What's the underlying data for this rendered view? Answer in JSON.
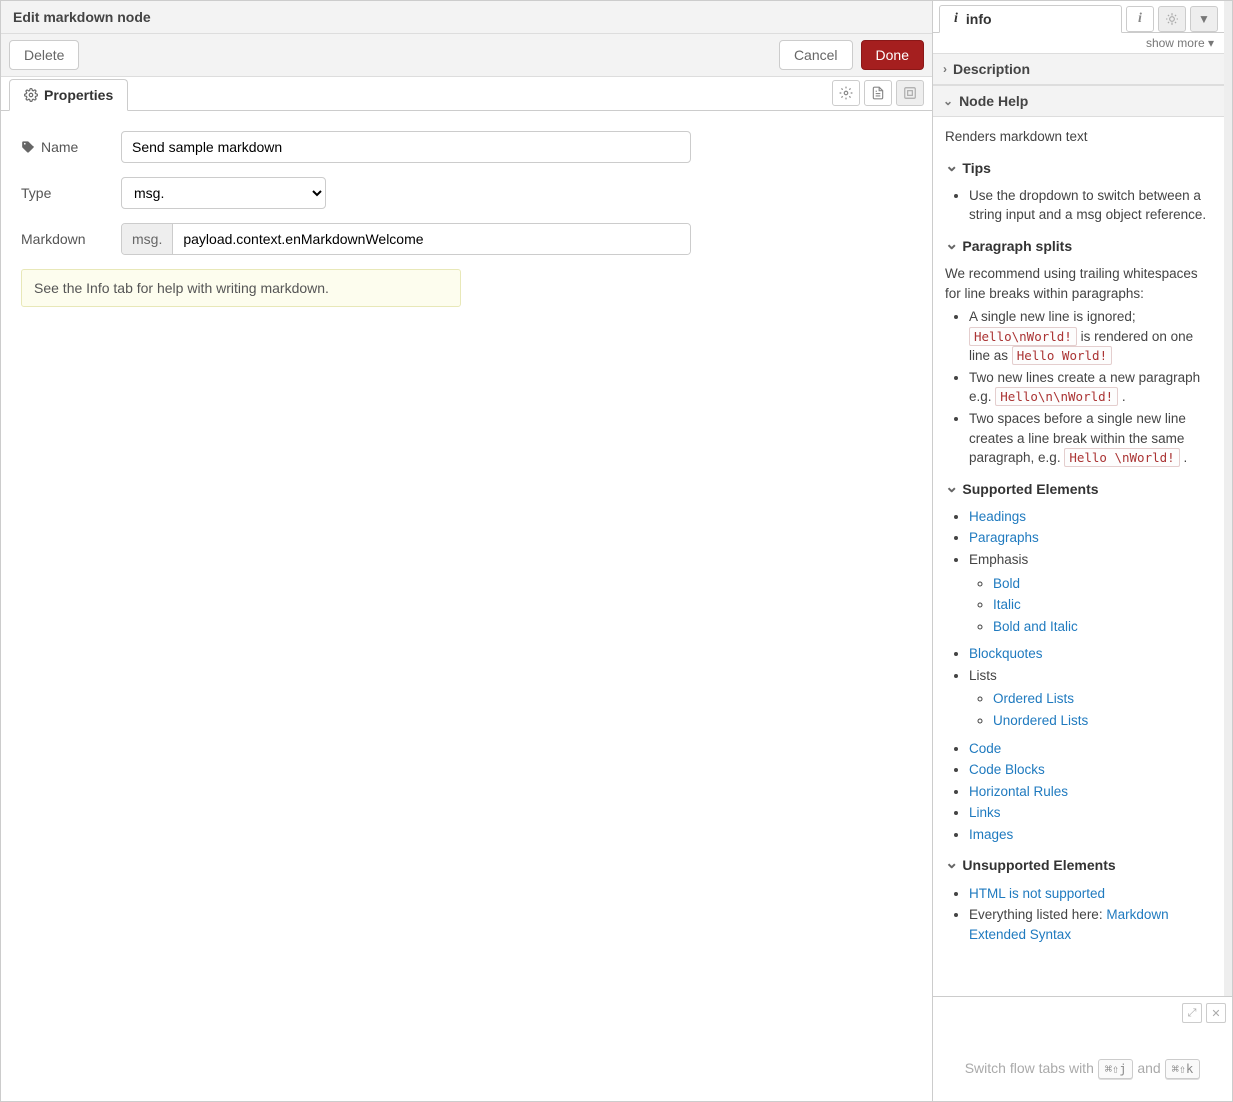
{
  "header": {
    "title": "Edit markdown node"
  },
  "toolbar": {
    "delete_label": "Delete",
    "cancel_label": "Cancel",
    "done_label": "Done"
  },
  "tabs": {
    "properties_label": "Properties"
  },
  "form": {
    "name_label": "Name",
    "name_value": "Send sample markdown",
    "type_label": "Type",
    "type_value": "msg.",
    "markdown_label": "Markdown",
    "markdown_prefix": "msg.",
    "markdown_value": "payload.context.enMarkdownWelcome",
    "info_callout": "See the Info tab for help with writing markdown."
  },
  "sidebar": {
    "tab_label": "info",
    "show_more": "show more ▾",
    "sections": {
      "description_title": "Description",
      "nodehelp_title": "Node Help"
    },
    "help": {
      "intro": "Renders markdown text",
      "tips_title": "Tips",
      "tips_items": [
        "Use the dropdown to switch between a string input and a msg object reference."
      ],
      "para_title": "Paragraph splits",
      "para_intro": "We recommend using trailing whitespaces for line breaks within paragraphs:",
      "para_items": {
        "b1_a": "A single new line is ignored; ",
        "b1_code1": "Hello\\nWorld!",
        "b1_b": " is rendered on one line as ",
        "b1_code2": "Hello World!",
        "b2_a": "Two new lines create a new paragraph e.g. ",
        "b2_code1": "Hello\\n\\nWorld!",
        "b2_b": " .",
        "b3_a": "Two spaces before a single new line creates a line break within the same paragraph, e.g. ",
        "b3_code1": "Hello \\nWorld!",
        "b3_b": " ."
      },
      "supported_title": "Supported Elements",
      "supported": {
        "headings": "Headings",
        "paragraphs": "Paragraphs",
        "emphasis": "Emphasis",
        "bold": "Bold",
        "italic": "Italic",
        "bold_italic": "Bold and Italic",
        "blockquotes": "Blockquotes",
        "lists": "Lists",
        "ordered": "Ordered Lists",
        "unordered": "Unordered Lists",
        "code": "Code",
        "code_blocks": "Code Blocks",
        "hr": "Horizontal Rules",
        "links": "Links",
        "images": "Images"
      },
      "unsupported_title": "Unsupported Elements",
      "unsupported": {
        "html": "HTML is not supported",
        "ext_a": "Everything listed here: ",
        "ext_link": "Markdown Extended Syntax"
      }
    },
    "footer": {
      "hint_prefix": "Switch flow tabs with ",
      "kbd1": "⌘⇧j",
      "hint_mid": " and ",
      "kbd2": "⌘⇧k"
    }
  }
}
